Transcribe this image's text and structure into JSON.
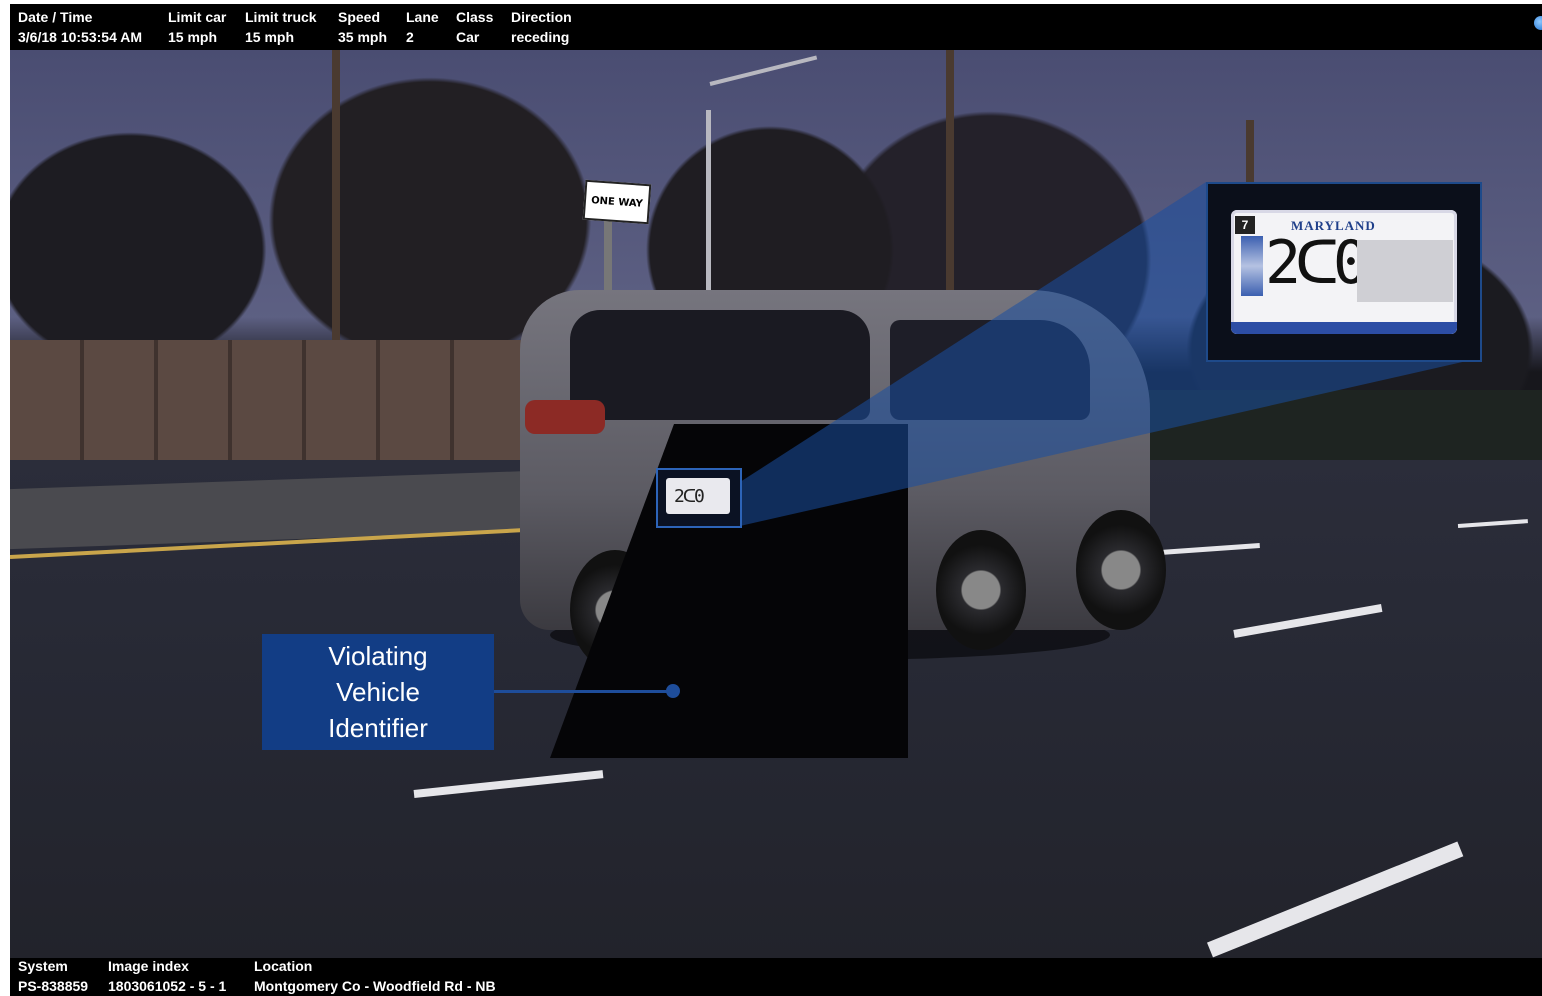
{
  "header": {
    "fields": [
      {
        "label": "Date / Time",
        "value": "3/6/18 10:53:54 AM"
      },
      {
        "label": "Limit car",
        "value": "15 mph"
      },
      {
        "label": "Limit truck",
        "value": "15 mph"
      },
      {
        "label": "Speed",
        "value": "35 mph"
      },
      {
        "label": "Lane",
        "value": "2"
      },
      {
        "label": "Class",
        "value": "Car"
      },
      {
        "label": "Direction",
        "value": "receding"
      }
    ]
  },
  "footer": {
    "fields": [
      {
        "label": "System",
        "value": "PS-838859"
      },
      {
        "label": "Image index",
        "value": "1803061052 - 5 - 1"
      },
      {
        "label": "Location",
        "value": "Montgomery Co - Woodfield Rd - NB"
      }
    ]
  },
  "scene": {
    "sign_text": "ONE WAY",
    "plate": {
      "sticker": "7",
      "state": "MARYLAND",
      "number_visible": "2ᑕ0",
      "small_number": "2ᑕ0"
    }
  },
  "callout": {
    "text": "Violating Vehicle Identifier"
  },
  "colors": {
    "overlay_blue": "#123d85",
    "beam_blue": "#1a4fa0",
    "strip_background": "#000000",
    "strip_text": "#ffffff"
  },
  "icons": [
    "globe-icon"
  ]
}
